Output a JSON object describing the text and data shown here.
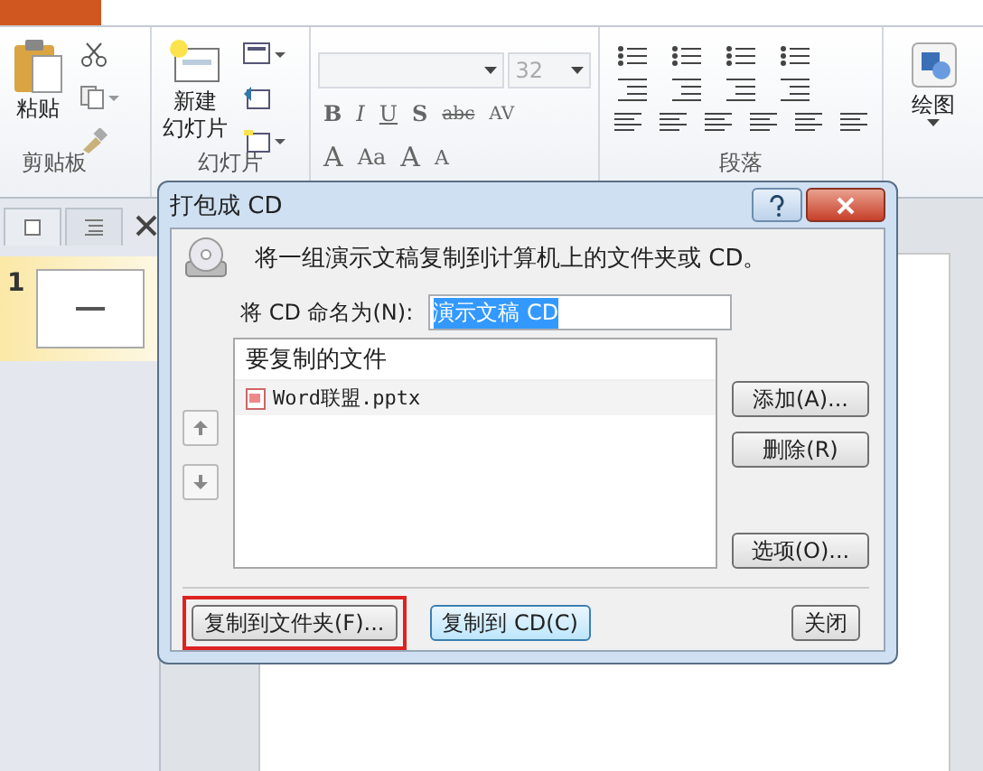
{
  "ribbon": {
    "clipboard": {
      "paste_label": "粘贴",
      "group_label": "剪贴板"
    },
    "slides": {
      "new_slide_label_1": "新建",
      "new_slide_label_2": "幻灯片",
      "group_label": "幻灯片"
    },
    "font": {
      "font_size": "32",
      "row1": [
        "B",
        "I",
        "U",
        "S",
        "abc",
        "AV"
      ],
      "row2": [
        "A",
        "Aa",
        "A",
        "A"
      ]
    },
    "paragraph": {
      "group_label": "段落"
    },
    "drawing": {
      "label": "绘图"
    }
  },
  "slide_pane": {
    "slides": [
      {
        "number": "1",
        "selected": true
      }
    ]
  },
  "dialog": {
    "title": "打包成 CD",
    "description": "将一组演示文稿复制到计算机上的文件夹或 CD。",
    "name_label": "将 CD 命名为(N):",
    "name_value": "演示文稿 CD",
    "list_header": "要复制的文件",
    "files": [
      {
        "name": "Word联盟.pptx"
      }
    ],
    "side_buttons": [
      "添加(A)...",
      "删除(R)",
      "选项(O)..."
    ],
    "footer_buttons": [
      {
        "label": "复制到文件夹(F)...",
        "focused": false,
        "marked": true
      },
      {
        "label": "复制到 CD(C)",
        "focused": true,
        "marked": false
      },
      {
        "label": "关闭",
        "focused": false,
        "marked": false
      }
    ]
  }
}
